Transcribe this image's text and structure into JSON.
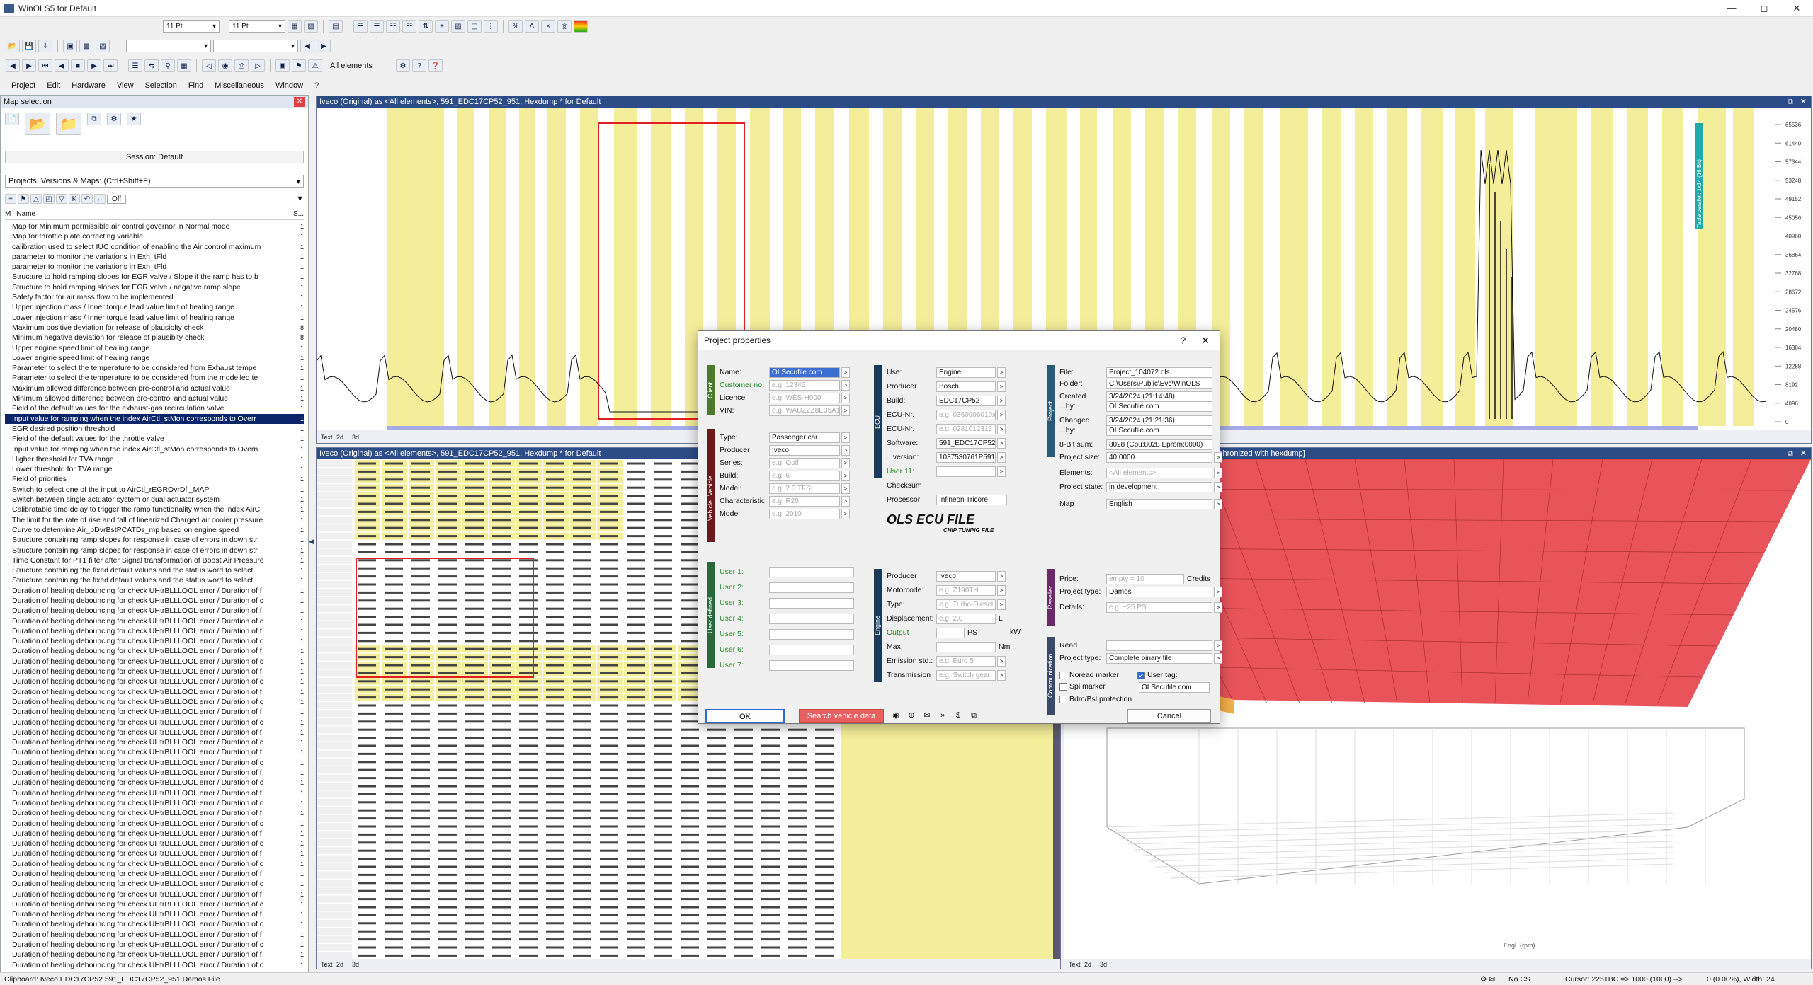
{
  "window": {
    "title": "WinOLS5 for Default"
  },
  "toolbar1": {
    "font_size_a": "11 Pt",
    "font_size_b": "11 Pt"
  },
  "toolbar3": {
    "elements_label": "All elements"
  },
  "menu": [
    "Project",
    "Edit",
    "Hardware",
    "View",
    "Selection",
    "Find",
    "Miscellaneous",
    "Window",
    "?"
  ],
  "map_selection": {
    "title": "Map selection",
    "session": "Session: Default",
    "search_placeholder": "Projects, Versions & Maps:  (Ctrl+Shift+F)",
    "filter_off": "Off",
    "col_m": "M",
    "col_name": "Name",
    "col_s": "S...",
    "items": [
      {
        "name": "Map for Minimum permissible air control governor in Normal mode",
        "s": "1"
      },
      {
        "name": "Map for throttle plate correcting variable",
        "s": "1"
      },
      {
        "name": "calibration used to select IUC condition of enabling the Air control maximum",
        "s": "1"
      },
      {
        "name": "parameter to monitor the variations in Exh_tFld",
        "s": "1"
      },
      {
        "name": "parameter to monitor the variations in Exh_tFld",
        "s": "1"
      },
      {
        "name": "Structure to hold ramping slopes for EGR valve / Slope if the ramp has to b",
        "s": "1"
      },
      {
        "name": "Structure to hold ramping slopes for EGR valve / negative ramp slope",
        "s": "1"
      },
      {
        "name": "Safety factor for air mass flow to be implemented",
        "s": "1"
      },
      {
        "name": "Upper injection mass / Inner torque lead value limit of healing range",
        "s": "1"
      },
      {
        "name": "Lower injection mass / Inner torque lead value limit of healing range",
        "s": "1"
      },
      {
        "name": "Maximum positive deviation for release of plausiblty check",
        "s": "8"
      },
      {
        "name": "Minimum negative deviation for release of plausiblty check",
        "s": "8"
      },
      {
        "name": "Upper engine speed limit of healing range",
        "s": "1"
      },
      {
        "name": "Lower engine speed limit of healing range",
        "s": "1"
      },
      {
        "name": "Parameter to select the temperature to be considered from Exhaust tempe",
        "s": "1"
      },
      {
        "name": "Parameter to select the temperature to be considered from the modelled te",
        "s": "1"
      },
      {
        "name": "Maximum allowed difference between pre-control and actual value",
        "s": "1"
      },
      {
        "name": "Minimum allowed difference between pre-control and actual value",
        "s": "1"
      },
      {
        "name": "Field of the default values for the exhaust-gas recirculation valve",
        "s": "1"
      },
      {
        "name": "Input value for ramping when the index AirCtl_stMon corresponds to Overr",
        "s": "1",
        "selected": true
      },
      {
        "name": "EGR desired position threshold",
        "s": "1"
      },
      {
        "name": "Field of the default values for the throttle valve",
        "s": "1"
      },
      {
        "name": "Input value for ramping when the index AirCtl_stMon corresponds to Overn",
        "s": "1"
      },
      {
        "name": "Higher threshold for TVA range",
        "s": "1"
      },
      {
        "name": "Lower threshold for TVA range",
        "s": "1"
      },
      {
        "name": "Field of priorities",
        "s": "1"
      },
      {
        "name": "Switch to select one of the input to AirCtl_rEGROvrDfl_MAP",
        "s": "1"
      },
      {
        "name": "Switch between single actuator system or dual actuator system",
        "s": "1"
      },
      {
        "name": "Calibratable time delay to trigger the ramp functionality when the index AirC",
        "s": "1"
      },
      {
        "name": "The limit for the rate of rise and fall of linearized Charged air cooler pressure",
        "s": "1"
      },
      {
        "name": "Curve to determine Air_pDvrBstPCATDs_mp based on engine speed",
        "s": "1"
      },
      {
        "name": "Structure containing ramp slopes for response in case of errors in down str",
        "s": "1"
      },
      {
        "name": "Structure containing ramp slopes for response in case of errors in down str",
        "s": "1"
      },
      {
        "name": "Time Constant for PT1 filter after Signal transformation of Boost Air Pressure",
        "s": "1"
      },
      {
        "name": "Structure containing the fixed default values and the status word to select",
        "s": "1"
      },
      {
        "name": "Structure containing the fixed default values and the status word to select",
        "s": "1"
      },
      {
        "name": "Duration of healing debouncing for check UHtrBLLLOOL error / Duration of f",
        "s": "1"
      },
      {
        "name": "Duration of healing debouncing for check UHtrBLLLOOL error / Duration of c",
        "s": "1"
      },
      {
        "name": "Duration of healing debouncing for check UHtrBLLLOOL error / Duration of f",
        "s": "1"
      },
      {
        "name": "Duration of healing debouncing for check UHtrBLLLOOL error / Duration of c",
        "s": "1"
      },
      {
        "name": "Duration of healing debouncing for check UHtrBLLLOOL error / Duration of f",
        "s": "1"
      },
      {
        "name": "Duration of healing debouncing for check UHtrBLLLOOL error / Duration of c",
        "s": "1"
      },
      {
        "name": "Duration of healing debouncing for check UHtrBLLLOOL error / Duration of f",
        "s": "1"
      },
      {
        "name": "Duration of healing debouncing for check UHtrBLLLOOL error / Duration of c",
        "s": "1"
      },
      {
        "name": "Duration of healing debouncing for check UHtrBLLLOOL error / Duration of f",
        "s": "1"
      },
      {
        "name": "Duration of healing debouncing for check UHtrBLLLOOL error / Duration of c",
        "s": "1"
      },
      {
        "name": "Duration of healing debouncing for check UHtrBLLLOOL error / Duration of f",
        "s": "1"
      },
      {
        "name": "Duration of healing debouncing for check UHtrBLLLOOL error / Duration of c",
        "s": "1"
      },
      {
        "name": "Duration of healing debouncing for check UHtrBLLLOOL error / Duration of f",
        "s": "1"
      },
      {
        "name": "Duration of healing debouncing for check UHtrBLLLOOL error / Duration of c",
        "s": "1"
      },
      {
        "name": "Duration of healing debouncing for check UHtrBLLLOOL error / Duration of f",
        "s": "1"
      },
      {
        "name": "Duration of healing debouncing for check UHtrBLLLOOL error / Duration of c",
        "s": "1"
      },
      {
        "name": "Duration of healing debouncing for check UHtrBLLLOOL error / Duration of f",
        "s": "1"
      },
      {
        "name": "Duration of healing debouncing for check UHtrBLLLOOL error / Duration of c",
        "s": "1"
      },
      {
        "name": "Duration of healing debouncing for check UHtrBLLLOOL error / Duration of f",
        "s": "1"
      },
      {
        "name": "Duration of healing debouncing for check UHtrBLLLOOL error / Duration of c",
        "s": "1"
      },
      {
        "name": "Duration of healing debouncing for check UHtrBLLLOOL error / Duration of f",
        "s": "1"
      },
      {
        "name": "Duration of healing debouncing for check UHtrBLLLOOL error / Duration of c",
        "s": "1"
      },
      {
        "name": "Duration of healing debouncing for check UHtrBLLLOOL error / Duration of f",
        "s": "1"
      },
      {
        "name": "Duration of healing debouncing for check UHtrBLLLOOL error / Duration of c",
        "s": "1"
      },
      {
        "name": "Duration of healing debouncing for check UHtrBLLLOOL error / Duration of f",
        "s": "1"
      },
      {
        "name": "Duration of healing debouncing for check UHtrBLLLOOL error / Duration of c",
        "s": "1"
      },
      {
        "name": "Duration of healing debouncing for check UHtrBLLLOOL error / Duration of f",
        "s": "1"
      },
      {
        "name": "Duration of healing debouncing for check UHtrBLLLOOL error / Duration of c",
        "s": "1"
      },
      {
        "name": "Duration of healing debouncing for check UHtrBLLLOOL error / Duration of f",
        "s": "1"
      },
      {
        "name": "Duration of healing debouncing for check UHtrBLLLOOL error / Duration of c",
        "s": "1"
      },
      {
        "name": "Duration of healing debouncing for check UHtrBLLLOOL error / Duration of f",
        "s": "1"
      },
      {
        "name": "Duration of healing debouncing for check UHtrBLLLOOL error / Duration of c",
        "s": "1"
      },
      {
        "name": "Duration of healing debouncing for check UHtrBLLLOOL error / Duration of f",
        "s": "1"
      },
      {
        "name": "Duration of healing debouncing for check UHtrBLLLOOL error / Duration of c",
        "s": "1"
      },
      {
        "name": "Duration of healing debouncing for check UHtrBLLLOOL error / Duration of f",
        "s": "1"
      },
      {
        "name": "Duration of healing debouncing for check UHtrBLLLOOL error / Duration of c",
        "s": "1"
      },
      {
        "name": "Duration of healing debouncing for check UHtrBLLLOOL error / Duration of f",
        "s": "1"
      },
      {
        "name": "Duration of healing debouncing for check UHtrBLLLOOL error / Duration of c",
        "s": "1"
      }
    ]
  },
  "graph_window": {
    "title": "Iveco (Original) as <All elements>, 591_EDC17CP52_951, Hexdump * for Default",
    "y_ticks": [
      "65536",
      "61440",
      "57344",
      "53248",
      "49152",
      "45056",
      "40960",
      "36864",
      "32768",
      "28672",
      "24576",
      "20480",
      "16384",
      "12288",
      "8192",
      "4096",
      "0"
    ],
    "bottom_tabs": [
      "Text",
      "2d",
      "3d"
    ],
    "side_label": "Table parallel: 1x14 (16 Bit)"
  },
  "hex_window": {
    "title": "Iveco (Original) as <All elements>, 591_EDC17CP52_951, Hexdump * for Default",
    "tabs": [
      "Text",
      "2d",
      "3d"
    ]
  },
  "plot3d_window": {
    "title": "AirCtl_stMon corresponds to Overrun *  [Synchronized with hexdump]",
    "tabs": [
      "Text",
      "2d",
      "3d"
    ],
    "axis_label": "Engl. (rpm)"
  },
  "dialog": {
    "title": "Project properties",
    "help": "?",
    "close": "✕",
    "client": {
      "tag": "Client",
      "name_label": "Name:",
      "name_value": "OLSecufile.com",
      "customer_label": "Customer no:",
      "customer_ph": "e.g. 12345",
      "licence_label": "Licence",
      "licence_ph": "e.g. WES-H900",
      "vin_label": "VIN:",
      "vin_ph": "e.g. WAUZZZ8E35A123..."
    },
    "vehicle": {
      "tag": "Vehicle",
      "type_label": "Type:",
      "type_value": "Passenger car",
      "producer_label": "Producer",
      "producer_value": "Iveco",
      "series_label": "Series:",
      "series_ph": "e.g. Golf",
      "build_label": "Build:",
      "build_ph": "e.g. 6",
      "model_label": "Model:",
      "model_ph": "e.g. 2.0 TFSI",
      "char_label": "Characteristic:",
      "char_ph": "e.g. R20",
      "model2_label": "Model",
      "model2_ph": "e.g. 2010"
    },
    "user": {
      "tag": "User defined",
      "labels": [
        "User 1:",
        "User 2:",
        "User 3:",
        "User 4:",
        "User 5:",
        "User 6:",
        "User 7:"
      ]
    },
    "ecu": {
      "tag": "ECU",
      "use_label": "Use:",
      "use_value": "Engine",
      "producer_label": "Producer",
      "producer_value": "Bosch",
      "build_label": "Build:",
      "build_value": "EDC17CP52",
      "ecunr_label": "ECU-Nr.",
      "ecunr_ph": "e.g. 0360906010x",
      "ecunr2_label": "ECU-Nr.",
      "ecunr2_ph": "e.g. 0281012313",
      "software_label": "Software:",
      "software_value": "591_EDC17CP52_",
      "version_label": "...version:",
      "version_value": "1037530761P591V",
      "user11_label": "User 11:",
      "checksum_label": "Checksum",
      "processor_label": "Processor",
      "processor_value": "Infineon Tricore"
    },
    "logo": {
      "main": "OLS ECU FILE",
      "sub": "CHIP TUNING FILE"
    },
    "engine": {
      "tag": "Engine",
      "producer_label": "Producer",
      "producer_value": "Iveco",
      "motorcode_label": "Motorcode:",
      "motorcode_ph": "e.g. Z190TH",
      "type_label": "Type:",
      "type_ph": "e.g. Turbo-Diesel",
      "displacement_label": "Displacement:",
      "displacement_ph": "e.g. 2.0",
      "displacement_unit": "L",
      "output_label": "Output",
      "output_unit1": "PS",
      "output_unit2": "kW",
      "max_label": "Max.",
      "max_unit": "Nm",
      "emission_label": "Emission std.:",
      "emission_ph": "e.g. Euro 5",
      "transmission_label": "Transmission",
      "transmission_ph": "e.g. Switch gear"
    },
    "project": {
      "tag": "Project",
      "file_label": "File:",
      "file_value": "Project_104072.ols",
      "folder_label": "Folder:",
      "folder_value": "C:\\Users\\Public\\Evc\\WinOLS",
      "created_label": "Created",
      "created_value": "3/24/2024 (21:14:48)",
      "createdby_label": "...by:",
      "createdby_value": "OLSecufile.com",
      "changed_label": "Changed",
      "changed_value": "3/24/2024 (21:21:36)",
      "changedby_label": "...by:",
      "changedby_value": "OLSecufile.com",
      "bitsum_label": "8-Bit sum:",
      "bitsum_value": "8028 (Cpu:8028 Eprom:0000)",
      "size_label": "Project size:",
      "size_value": "40.0000",
      "elements_label": "Elements:",
      "elements_value": "<All elements>",
      "state_label": "Project state:",
      "state_value": "in development",
      "map_label": "Map",
      "map_value": "English"
    },
    "reseller": {
      "tag": "Reseller",
      "price_label": "Price:",
      "price_ph": "empty = 10",
      "price_unit": "Credits",
      "ptype_label": "Project type:",
      "ptype_value": "Damos",
      "details_label": "Details:",
      "details_ph": "e.g. +25 PS"
    },
    "communication": {
      "tag": "Communication",
      "read_label": "Read",
      "ptype_label": "Project type:",
      "ptype_value": "Complete binary file",
      "noread_label": "Noread marker",
      "usertag_label": "User tag:",
      "usertag_value": "OLSecufile.com",
      "spi_label": "Spi marker",
      "bdm_label": "Bdm/Bsl protection"
    },
    "ok": "OK",
    "search_vehicle": "Search vehicle data",
    "cancel": "Cancel"
  },
  "statusbar": {
    "left": "Clipboard: Iveco EDC17CP52 591_EDC17CP52_951 Damos File",
    "nocs": "No CS",
    "cursor": "Cursor: 2251BC => 1000 (1000) -->",
    "pct": "0 (0.00%), Width: 24"
  },
  "colors": {
    "title_blue": "#2b4c86",
    "hex_yellow": "#f4ee9a",
    "surface_red": "#e8545a",
    "ok_green": "#2a7a2a"
  }
}
